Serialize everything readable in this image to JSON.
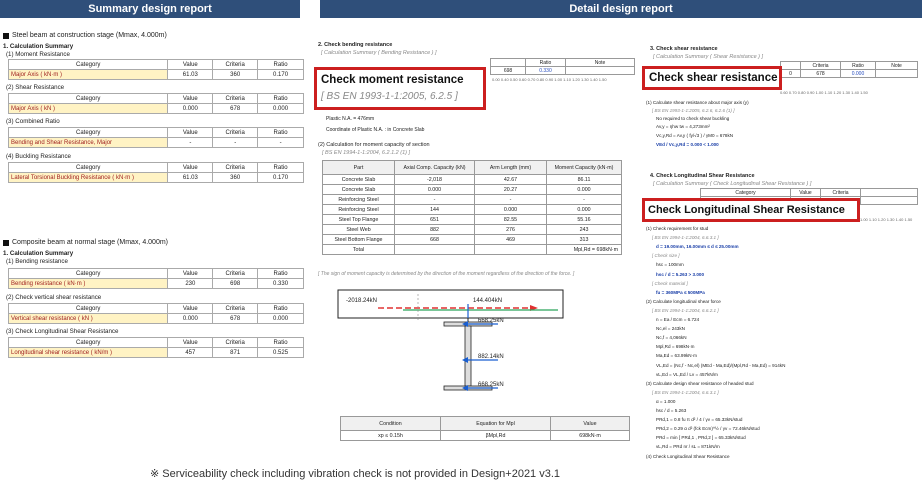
{
  "banners": {
    "left": "Summary design report",
    "right": "Detail design report"
  },
  "left": {
    "construction": {
      "heading": "Steel beam at construction stage (Mmax, 4.000m)",
      "calc_summary": "1. Calculation Summary",
      "moment": {
        "label": "(1) Moment Resistance",
        "row": {
          "category": "Major Axis ( kN·m )",
          "value": "61.03",
          "criteria": "360",
          "ratio": "0.170"
        }
      },
      "shear": {
        "label": "(2) Shear Resistance",
        "row": {
          "category": "Major Axis ( kN )",
          "value": "0.000",
          "criteria": "678",
          "0": "",
          "ratio": "0.000"
        }
      },
      "combined": {
        "label": "(3) Combined Ratio",
        "row": {
          "category": "Bending and Shear Resistance, Major",
          "value": "-",
          "criteria": "-",
          "ratio": "-"
        }
      },
      "buckling": {
        "label": "(4) Buckling Resistance",
        "row": {
          "category": "Lateral Torsional Buckling Resistance ( kN·m )",
          "value": "61.03",
          "criteria": "360",
          "ratio": "0.170"
        }
      }
    },
    "composite": {
      "heading": "Composite beam at normal stage (Mmax, 4.000m)",
      "calc_summary": "1. Calculation Summary",
      "bending": {
        "label": "(1) Bending resistance",
        "row": {
          "category": "Bending resistance ( kN·m )",
          "value": "230",
          "criteria": "698",
          "ratio": "0.330"
        }
      },
      "vshear": {
        "label": "(2) Check vertical shear resistance",
        "row": {
          "category": "Vertical shear resistance ( kN )",
          "value": "0.000",
          "criteria": "678",
          "ratio": "0.000"
        }
      },
      "longshear": {
        "label": "(3) Check Longitudinal Shear Resistance",
        "row": {
          "category": "Longitudinal shear resistance ( kN/m )",
          "value": "457",
          "criteria": "871",
          "ratio": "0.525"
        }
      }
    },
    "headers": {
      "category": "Category",
      "value": "Value",
      "criteria": "Criteria",
      "ratio": "Ratio"
    }
  },
  "detail": {
    "bending": {
      "heading": "2. Check bending resistance",
      "sub": "[ Calculation Summary ( Bending Resistance ) ]",
      "box_title": "Check moment resistance",
      "box_ref": "[ BS EN 1993-1-1:2005, 6.2.5 ]",
      "mini": {
        "value": "698",
        "ratio": "0.330",
        "note": "Note",
        "ratio_h": "Ratio"
      },
      "axis": "0.00 0.40 0.50 0.60 0.70 0.80 0.90 1.00 1.10 1.20 1.30 1.40 1.50",
      "bullet1": "Plastic N.A. = 476mm",
      "bullet2": "Coordinate of Plastic N.A. : in Concrete Slab",
      "calc_head": "(2) Calculation for moment capacity of section",
      "calc_ref": "[ BS EN 1994-1-1:2004, 6.2.1.2 (1) ]",
      "table_headers": {
        "part": "Part",
        "axial": "Axial Comp. Capacity (kN)",
        "arm": "Arm Length (mm)",
        "moment": "Moment Capacity (kN·m)"
      },
      "rows": [
        {
          "part": "Concrete Slab",
          "axial": "-2,018",
          "arm": "42.67",
          "moment": "86.11"
        },
        {
          "part": "Concrete Slab",
          "axial": "0.000",
          "arm": "20.27",
          "moment": "0.000"
        },
        {
          "part": "Reinforcing Steel",
          "axial": "-",
          "arm": "-",
          "moment": "-"
        },
        {
          "part": "Reinforcing Steel",
          "axial": "144",
          "arm": "0.000",
          "moment": "0.000"
        },
        {
          "part": "Steel Top Flange",
          "axial": "651",
          "arm": "82.55",
          "moment": "55.16"
        },
        {
          "part": "Steel Web",
          "axial": "882",
          "arm": "276",
          "moment": "243"
        },
        {
          "part": "Steel Bottom Flange",
          "axial": "668",
          "arm": "469",
          "moment": "313"
        },
        {
          "part": "Total",
          "axial": "",
          "arm": "",
          "moment": "Mpl,Rd = 698kN·m"
        }
      ],
      "sign_note": "[ The sign of moment capacity is determined by the direction of the moment regardless of the direction of the force. ]",
      "diagram": {
        "f1": "-2018.24kN",
        "f2": "144.404kN",
        "f3": "668.25kN",
        "f4": "882.14kN",
        "f5": "668.25kN"
      },
      "cond_headers": {
        "condition": "Condition",
        "equation": "Equation for Mpl",
        "value": "Value"
      },
      "cond_row": {
        "condition": "xp ≤ 0.15h",
        "equation": "βMpl,Rd",
        "value": "698kN·m"
      }
    },
    "shear": {
      "heading": "3. Check shear resistance",
      "sub": "[ Calculation Summary ( Shear Resistance ) ]",
      "box_title": "Check shear resistance",
      "mini": {
        "criteria_h": "Criteria",
        "ratio_h": "Ratio",
        "note": "Note",
        "value": "0",
        "criteria": "678",
        "ratio": "0.000"
      },
      "axis": "0.60 0.70 0.80 0.90 1.00 1.10 1.20 1.30 1.40 1.50",
      "calc1": "(1) Calculate shear resistance about major axis (y)",
      "ref1": "[ BS EN 1993-1-1:2005, 6.2.6, 6.2.6 (1) ]",
      "b1": "No required to check shear buckling",
      "b2": "Av,y = ηhw tw = 4,273mm²",
      "b3": "Vc,y,Rd = Av,y ( fy/√3 ) / γM0 = 678kN",
      "b4": "VEd / Vc,y,Rd = 0.000 < 1.000"
    },
    "long": {
      "heading": "4. Check Longitudinal Shear Resistance",
      "sub": "[ Calculation Summary ( Check Longitudinal Shear Resistance ) ]",
      "category_h": "Category",
      "value_h": "Value",
      "criteria_h": "Criteria",
      "box_title": "Check Longitudinal Shear Resistance",
      "axis": "1.00 1.10 1.20 1.30 1.40 1.50",
      "lines": [
        "(1) Check requirement for stud",
        "[ BS EN 1994-1-1:2004, 6.6.3.1 ]",
        "d = 19.00mm, 16.00mm ≤ d ≤ 25.00mm",
        "[ Check size ]",
        "hsc = 100mm",
        "hsc / d = 5.263 > 3.000",
        "[ Check material ]",
        "fu = 360MPa ≤ 500MPa",
        "(2) Calculate longitudinal shear force",
        "[ BS EN 1994-1-1:2004, 6.6.2.1 ]",
        "n = Ea / Ecm = 6.724",
        "Nc,el = 243kN",
        "Nc,f = 4,066kN",
        "Mpl,Rd = 698kN·m",
        "Ma,Ed = 63.99kN·m",
        "VL,Ed = (Nc,f - Nc,el) (MEd - Ma,Ed)/(Mpl,Rd - Ma,Ed) = 914kN",
        "vL,Ed = VL,Ed / Lv = 457kN/m",
        "(3) Calculate design shear resistance of headed stud",
        "[ BS EN 1994-1-1:2004, 6.6.3.1 ]",
        "α = 1.000",
        "hsc / d = 5.263",
        "PRd,1 = 0.8 fu π d² / 4 / γv = 65.33kN/stud",
        "PRd,2 = 0.29 α d² (fck Ecm)^½ / γv = 72.46kN/stud",
        "PRd = min [ PRd,1 , PRd,2 ] = 65.33kN/stud",
        "vL,Rd = PRd nr / sL = 871kN/m",
        "(4) Check Longitudinal Shear Resistance"
      ]
    }
  },
  "footnote": "※ Serviceability check including vibration check is not provided in Design+2021 v3.1"
}
